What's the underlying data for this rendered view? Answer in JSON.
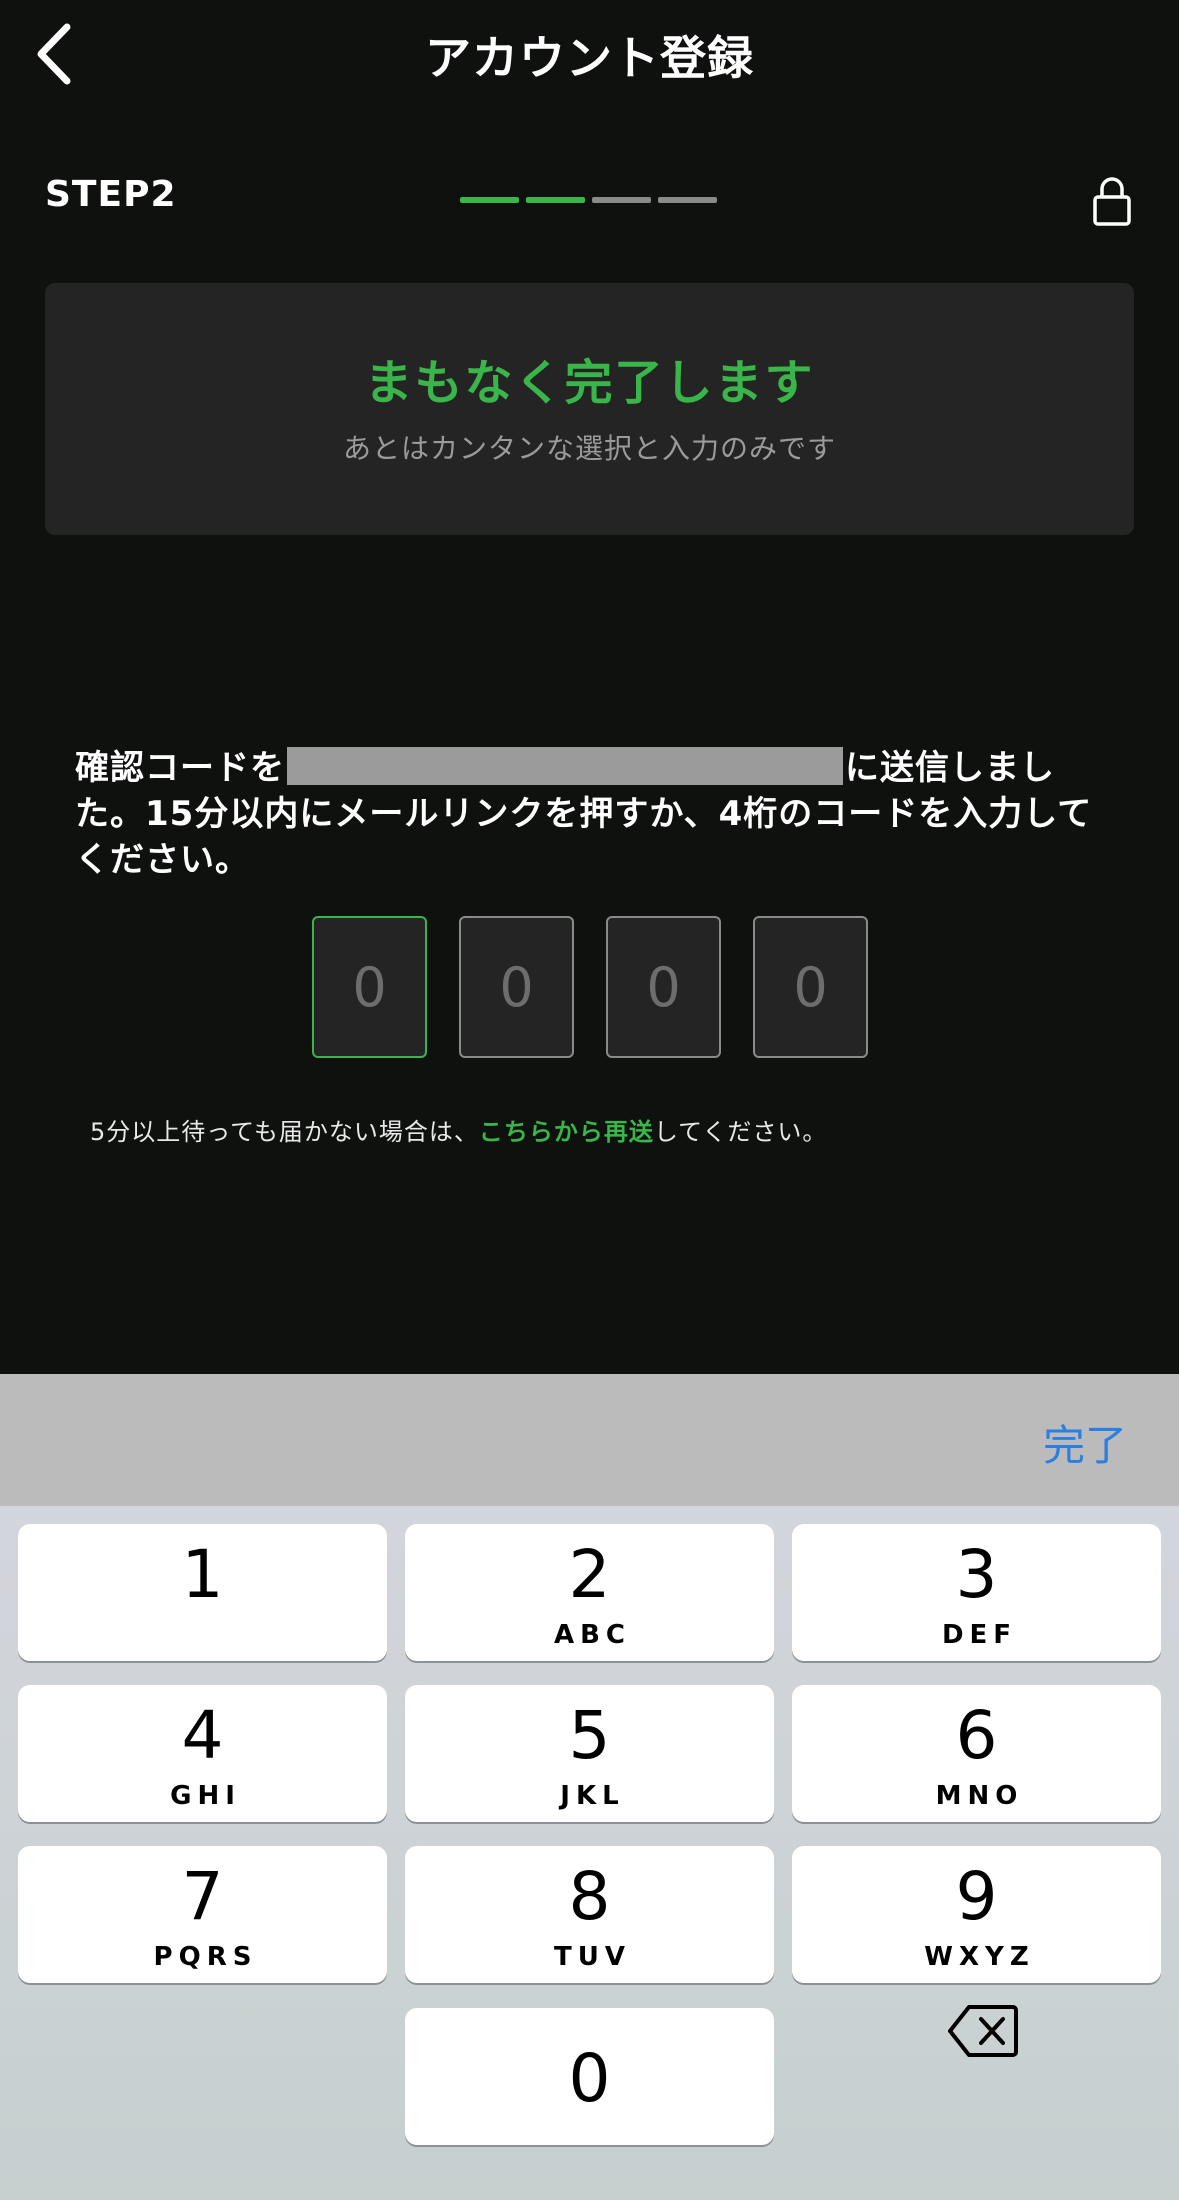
{
  "header": {
    "title": "アカウント登録",
    "back_icon": "chevron-left-icon"
  },
  "step": {
    "label": "STEP2",
    "progress_completed": 2,
    "progress_total": 4,
    "lock_icon": "lock-icon"
  },
  "banner": {
    "title": "まもなく完了します",
    "subtitle": "あとはカンタンな選択と入力のみです"
  },
  "message": {
    "before": "確認コードを",
    "after": "に送信しました。15分以内にメールリンクを押すか、4桁のコードを入力してください。"
  },
  "code_inputs": [
    {
      "placeholder": "0"
    },
    {
      "placeholder": "0"
    },
    {
      "placeholder": "0"
    },
    {
      "placeholder": "0"
    }
  ],
  "resend": {
    "before": "5分以上待っても届かない場合は、",
    "link": "こちらから再送",
    "after": "してください。"
  },
  "keyboard": {
    "done_label": "完了",
    "keys": [
      {
        "num": "1",
        "letters": ""
      },
      {
        "num": "2",
        "letters": "ABC"
      },
      {
        "num": "3",
        "letters": "DEF"
      },
      {
        "num": "4",
        "letters": "GHI"
      },
      {
        "num": "5",
        "letters": "JKL"
      },
      {
        "num": "6",
        "letters": "MNO"
      },
      {
        "num": "7",
        "letters": "PQRS"
      },
      {
        "num": "8",
        "letters": "TUV"
      },
      {
        "num": "9",
        "letters": "WXYZ"
      },
      {
        "num": "0",
        "letters": ""
      }
    ],
    "delete_icon": "backspace-icon"
  },
  "colors": {
    "accent": "#39b54a",
    "background": "#0f110f",
    "link_blue": "#2b7fe0"
  }
}
